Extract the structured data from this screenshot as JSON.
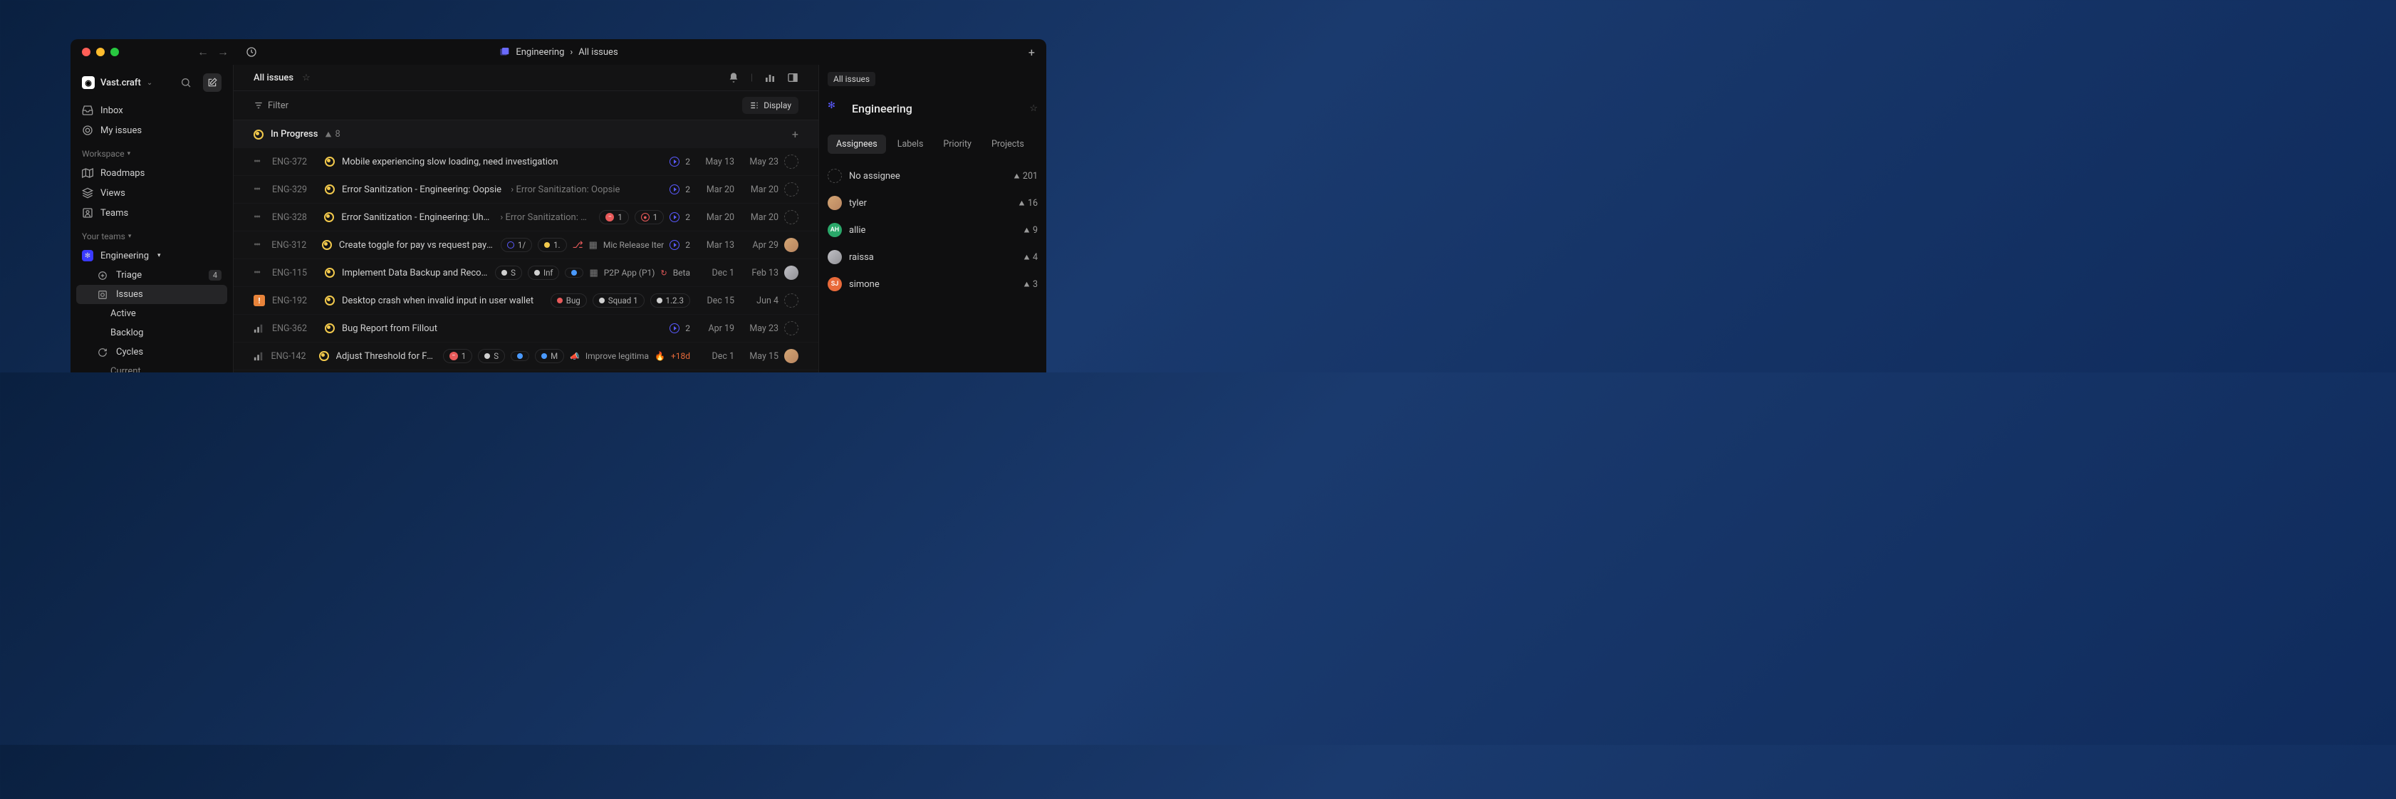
{
  "window": {
    "title_team": "Engineering",
    "title_view": "All issues"
  },
  "workspace": {
    "name": "Vast.craft"
  },
  "sidebar": {
    "inbox": "Inbox",
    "my_issues": "My issues",
    "workspace_label": "Workspace",
    "roadmaps": "Roadmaps",
    "views": "Views",
    "teams": "Teams",
    "your_teams_label": "Your teams",
    "team_name": "Engineering",
    "triage": "Triage",
    "triage_count": "4",
    "issues": "Issues",
    "active": "Active",
    "backlog": "Backlog",
    "cycles": "Cycles",
    "current": "Current"
  },
  "main": {
    "view_title": "All issues",
    "filter_label": "Filter",
    "display_label": "Display",
    "group_name": "In Progress",
    "group_count": "8"
  },
  "issues": [
    {
      "priority": "none",
      "id": "ENG-372",
      "title": "Mobile experiencing slow loading, need investigation",
      "rel_count": "2",
      "created": "May 13",
      "updated": "May 23",
      "assignee": "dashed"
    },
    {
      "priority": "none",
      "id": "ENG-329",
      "title": "Error Sanitization - Engineering: Oopsie",
      "subtitle": "Error Sanitization: Oopsie",
      "rel_count": "2",
      "created": "Mar 20",
      "updated": "Mar 20",
      "assignee": "dashed"
    },
    {
      "priority": "none",
      "id": "ENG-328",
      "title": "Error Sanitization - Engineering: Uh …",
      "subtitle": "Error Sanitization: U…",
      "block1": "1",
      "block2": "1",
      "rel_count": "2",
      "created": "Mar 20",
      "updated": "Mar 20",
      "assignee": "dashed"
    },
    {
      "priority": "none",
      "id": "ENG-312",
      "title": "Create toggle for pay vs request paym…",
      "tag1": "1/",
      "tag2": "1.",
      "project": "Mic Release Iter",
      "rel_count": "2",
      "created": "Mar 13",
      "updated": "Apr 29",
      "assignee": "img"
    },
    {
      "priority": "none",
      "id": "ENG-115",
      "title": "Implement Data Backup and Reco…",
      "tag_inf": "Inf",
      "tag_p2p": "P2P App (P1)",
      "tag_beta": "Beta",
      "created": "Dec 1",
      "updated": "Feb 13",
      "assignee": "img"
    },
    {
      "priority": "urgent",
      "id": "ENG-192",
      "title": "Desktop crash when invalid input in user wallet",
      "tag_bug": "Bug",
      "tag_squad": "Squad 1",
      "tag_ver": "1.2.3",
      "created": "Dec 15",
      "updated": "Jun 4",
      "assignee": "dashed"
    },
    {
      "priority": "bars",
      "id": "ENG-362",
      "title": "Bug Report from Fillout",
      "rel_count": "2",
      "created": "Apr 19",
      "updated": "May 23",
      "assignee": "dashed"
    },
    {
      "priority": "bars",
      "id": "ENG-142",
      "title": "Adjust Threshold for Frau…",
      "block1": "1",
      "tag_s": "S",
      "tag_m": "M",
      "project": "Improve legitima",
      "overdue": "+18d",
      "created": "Dec 1",
      "updated": "May 15",
      "assignee": "img"
    }
  ],
  "panel": {
    "chip": "All issues",
    "team_title": "Engineering",
    "tabs": {
      "assignees": "Assignees",
      "labels": "Labels",
      "priority": "Priority",
      "projects": "Projects"
    },
    "assignees": [
      {
        "name": "No assignee",
        "count": "201",
        "type": "dashed"
      },
      {
        "name": "tyler",
        "count": "16",
        "type": "tyler"
      },
      {
        "name": "allie",
        "count": "9",
        "type": "allie",
        "initials": "AH"
      },
      {
        "name": "raissa",
        "count": "4",
        "type": "raissa"
      },
      {
        "name": "simone",
        "count": "3",
        "type": "simone",
        "initials": "SJ"
      }
    ]
  }
}
